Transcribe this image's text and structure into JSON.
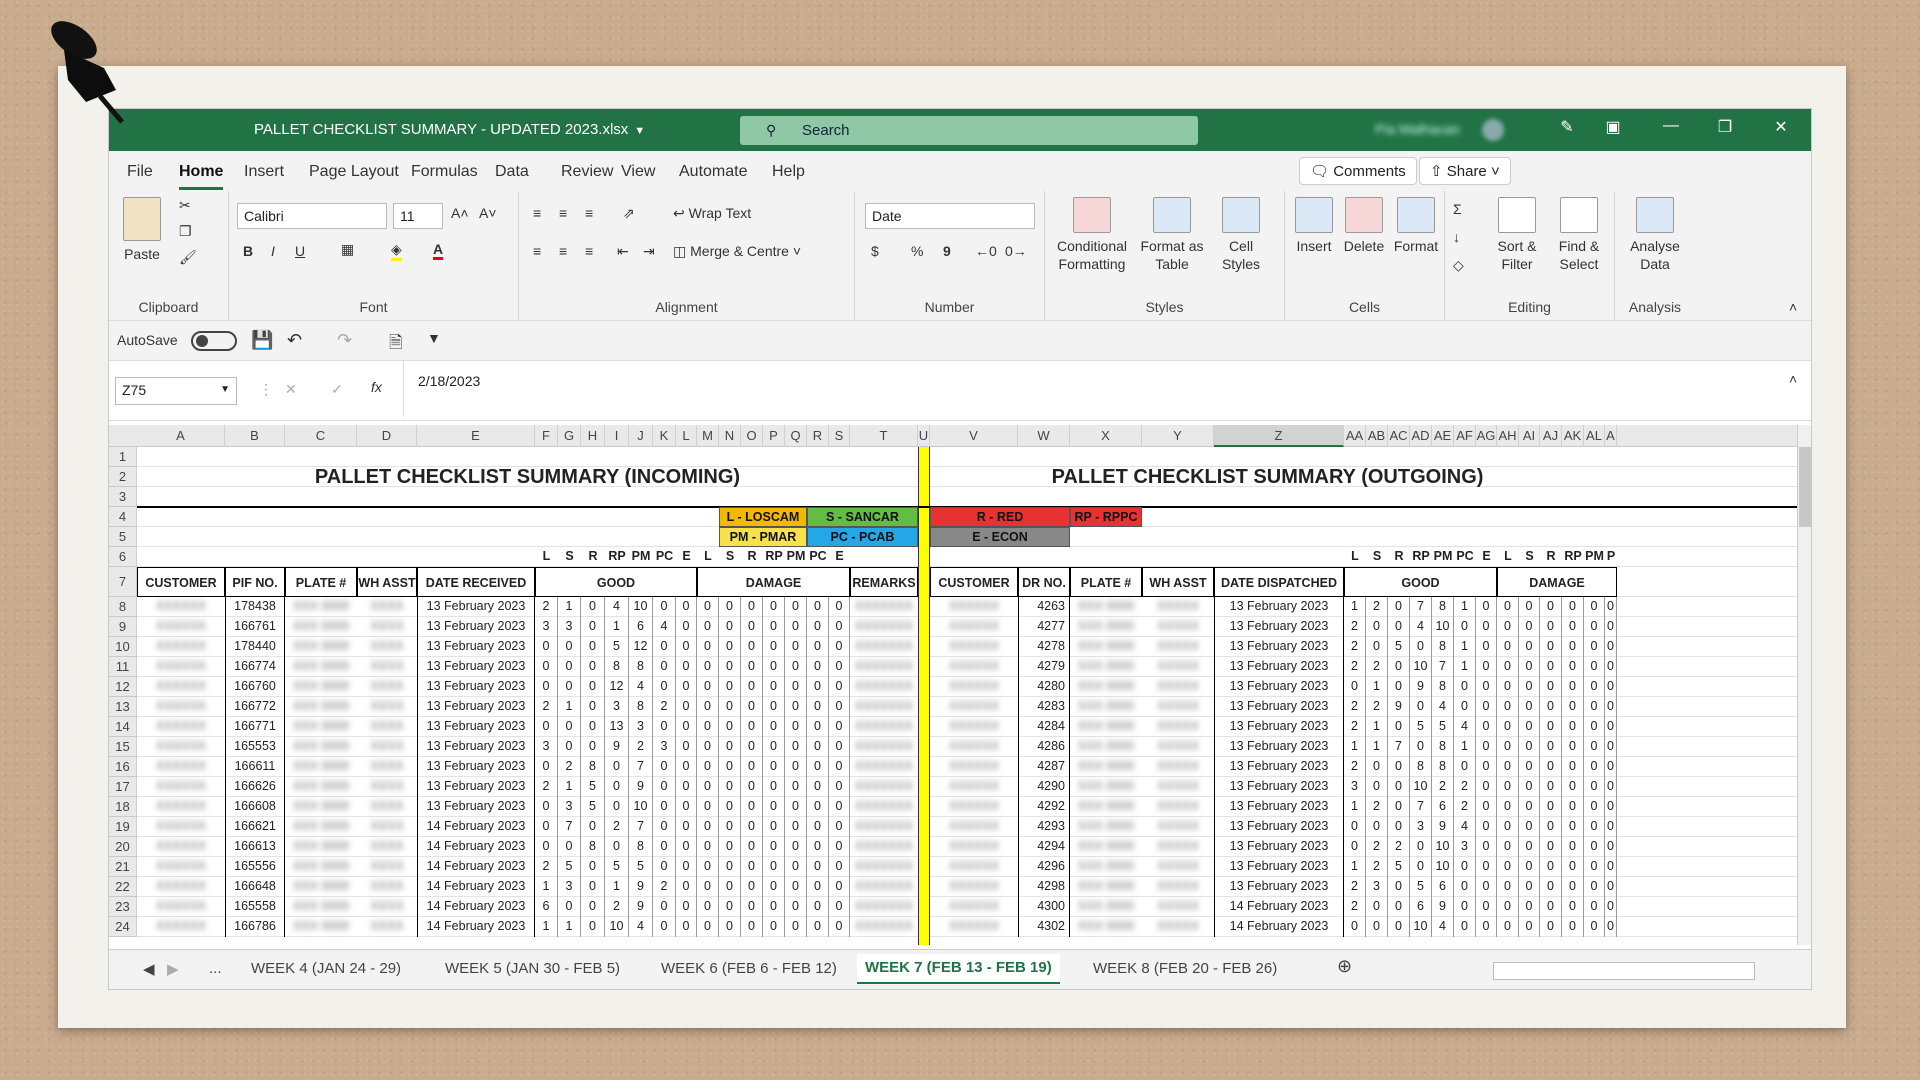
{
  "window": {
    "title": "PALLET CHECKLIST SUMMARY - UPDATED 2023.xlsx",
    "search_placeholder": "Search",
    "user": "Pia Malhacan"
  },
  "tabs": [
    "File",
    "Home",
    "Insert",
    "Page Layout",
    "Formulas",
    "Data",
    "Review",
    "View",
    "Automate",
    "Help"
  ],
  "active_tab": "Home",
  "ribbon_buttons": {
    "comments": "Comments",
    "share": "Share"
  },
  "ribbon": {
    "clipboard": {
      "paste": "Paste",
      "label": "Clipboard"
    },
    "font": {
      "name": "Calibri",
      "size": "11",
      "label": "Font",
      "bold": "B",
      "italic": "I",
      "underline": "U"
    },
    "alignment": {
      "wrap": "Wrap Text",
      "merge": "Merge & Centre",
      "label": "Alignment"
    },
    "number": {
      "format": "Date",
      "currency": "$",
      "percent": "%",
      "comma": "9",
      "label": "Number"
    },
    "styles": {
      "conditional": "Conditional Formatting",
      "format_table": "Format as Table",
      "cell_styles": "Cell Styles",
      "label": "Styles"
    },
    "cells": {
      "insert": "Insert",
      "delete": "Delete",
      "format": "Format",
      "label": "Cells"
    },
    "editing": {
      "sort": "Sort & Filter",
      "find": "Find & Select",
      "label": "Editing"
    },
    "analysis": {
      "analyse": "Analyse Data",
      "label": "Analysis"
    }
  },
  "qat": {
    "autosave": "AutoSave"
  },
  "formula_bar": {
    "name_box": "Z75",
    "value": "2/18/2023",
    "fx": "fx"
  },
  "columns_left": [
    "A",
    "B",
    "C",
    "D",
    "E",
    "F",
    "G",
    "H",
    "I",
    "J",
    "K",
    "L",
    "M",
    "N",
    "O",
    "P",
    "Q",
    "R",
    "S",
    "T",
    "U"
  ],
  "columns_right": [
    "V",
    "W",
    "X",
    "Y",
    "Z",
    "AA",
    "AB",
    "AC",
    "AD",
    "AE",
    "AF",
    "AG",
    "AH",
    "AI",
    "AJ",
    "AK",
    "AL",
    "A"
  ],
  "rows_nums": [
    "1",
    "2",
    "3",
    "4",
    "5",
    "6",
    "7",
    "8",
    "9",
    "10",
    "11",
    "12",
    "13",
    "14",
    "15",
    "16",
    "17",
    "18",
    "19",
    "20",
    "21",
    "22",
    "23",
    "24"
  ],
  "titles": {
    "incoming": "PALLET CHECKLIST SUMMARY (INCOMING)",
    "outgoing": "PALLET CHECKLIST SUMMARY (OUTGOING)"
  },
  "legend": [
    {
      "text": "L - LOSCAM",
      "bg": "#f5b800"
    },
    {
      "text": "S - SANCAR",
      "bg": "#63bd45"
    },
    {
      "text": "PM - PMAR",
      "bg": "#f7e24a"
    },
    {
      "text": "PC - PCAB",
      "bg": "#25a6e6"
    },
    {
      "text": "R - RED",
      "bg": "#e83232"
    },
    {
      "text": "RP - RPPC",
      "bg": "#e83232"
    },
    {
      "text": "E - ECON",
      "bg": "#888888"
    }
  ],
  "sub_codes_left": [
    "L",
    "S",
    "R",
    "RP",
    "PM",
    "PC",
    "E",
    "L",
    "S",
    "R",
    "RP",
    "PM",
    "PC",
    "E"
  ],
  "sub_codes_right": [
    "L",
    "S",
    "R",
    "RP",
    "PM",
    "PC",
    "E",
    "L",
    "S",
    "R",
    "RP",
    "PM",
    "P"
  ],
  "headers_left": [
    "CUSTOMER",
    "PIF NO.",
    "PLATE #",
    "WH ASST",
    "DATE RECEIVED",
    "GOOD",
    "DAMAGE",
    "REMARKS"
  ],
  "headers_right": [
    "CUSTOMER",
    "DR NO.",
    "PLATE #",
    "WH ASST",
    "DATE DISPATCHED",
    "GOOD",
    "DAMAGE"
  ],
  "incoming_rows": [
    {
      "pif": "178438",
      "date": "13 February 2023",
      "good": [
        "2",
        "1",
        "0",
        "4",
        "10",
        "0",
        "0"
      ],
      "damage": [
        "0",
        "0",
        "0",
        "0",
        "0",
        "0",
        "0"
      ]
    },
    {
      "pif": "166761",
      "date": "13 February 2023",
      "good": [
        "3",
        "3",
        "0",
        "1",
        "6",
        "4",
        "0"
      ],
      "damage": [
        "0",
        "0",
        "0",
        "0",
        "0",
        "0",
        "0"
      ]
    },
    {
      "pif": "178440",
      "date": "13 February 2023",
      "good": [
        "0",
        "0",
        "0",
        "5",
        "12",
        "0",
        "0"
      ],
      "damage": [
        "0",
        "0",
        "0",
        "0",
        "0",
        "0",
        "0"
      ]
    },
    {
      "pif": "166774",
      "date": "13 February 2023",
      "good": [
        "0",
        "0",
        "0",
        "8",
        "8",
        "0",
        "0"
      ],
      "damage": [
        "0",
        "0",
        "0",
        "0",
        "0",
        "0",
        "0"
      ]
    },
    {
      "pif": "166760",
      "date": "13 February 2023",
      "good": [
        "0",
        "0",
        "0",
        "12",
        "4",
        "0",
        "0"
      ],
      "damage": [
        "0",
        "0",
        "0",
        "0",
        "0",
        "0",
        "0"
      ]
    },
    {
      "pif": "166772",
      "date": "13 February 2023",
      "good": [
        "2",
        "1",
        "0",
        "3",
        "8",
        "2",
        "0"
      ],
      "damage": [
        "0",
        "0",
        "0",
        "0",
        "0",
        "0",
        "0"
      ]
    },
    {
      "pif": "166771",
      "date": "13 February 2023",
      "good": [
        "0",
        "0",
        "0",
        "13",
        "3",
        "0",
        "0"
      ],
      "damage": [
        "0",
        "0",
        "0",
        "0",
        "0",
        "0",
        "0"
      ]
    },
    {
      "pif": "165553",
      "date": "13 February 2023",
      "good": [
        "3",
        "0",
        "0",
        "9",
        "2",
        "3",
        "0"
      ],
      "damage": [
        "0",
        "0",
        "0",
        "0",
        "0",
        "0",
        "0"
      ]
    },
    {
      "pif": "166611",
      "date": "13 February 2023",
      "good": [
        "0",
        "2",
        "8",
        "0",
        "7",
        "0",
        "0"
      ],
      "damage": [
        "0",
        "0",
        "0",
        "0",
        "0",
        "0",
        "0"
      ]
    },
    {
      "pif": "166626",
      "date": "13 February 2023",
      "good": [
        "2",
        "1",
        "5",
        "0",
        "9",
        "0",
        "0"
      ],
      "damage": [
        "0",
        "0",
        "0",
        "0",
        "0",
        "0",
        "0"
      ]
    },
    {
      "pif": "166608",
      "date": "13 February 2023",
      "good": [
        "0",
        "3",
        "5",
        "0",
        "10",
        "0",
        "0"
      ],
      "damage": [
        "0",
        "0",
        "0",
        "0",
        "0",
        "0",
        "0"
      ]
    },
    {
      "pif": "166621",
      "date": "14 February 2023",
      "good": [
        "0",
        "7",
        "0",
        "2",
        "7",
        "0",
        "0"
      ],
      "damage": [
        "0",
        "0",
        "0",
        "0",
        "0",
        "0",
        "0"
      ]
    },
    {
      "pif": "166613",
      "date": "14 February 2023",
      "good": [
        "0",
        "0",
        "8",
        "0",
        "8",
        "0",
        "0"
      ],
      "damage": [
        "0",
        "0",
        "0",
        "0",
        "0",
        "0",
        "0"
      ]
    },
    {
      "pif": "165556",
      "date": "14 February 2023",
      "good": [
        "2",
        "5",
        "0",
        "5",
        "5",
        "0",
        "0"
      ],
      "damage": [
        "0",
        "0",
        "0",
        "0",
        "0",
        "0",
        "0"
      ]
    },
    {
      "pif": "166648",
      "date": "14 February 2023",
      "good": [
        "1",
        "3",
        "0",
        "1",
        "9",
        "2",
        "0"
      ],
      "damage": [
        "0",
        "0",
        "0",
        "0",
        "0",
        "0",
        "0"
      ]
    },
    {
      "pif": "165558",
      "date": "14 February 2023",
      "good": [
        "6",
        "0",
        "0",
        "2",
        "9",
        "0",
        "0"
      ],
      "damage": [
        "0",
        "0",
        "0",
        "0",
        "0",
        "0",
        "0"
      ]
    },
    {
      "pif": "166786",
      "date": "14 February 2023",
      "good": [
        "1",
        "1",
        "0",
        "10",
        "4",
        "0",
        "0"
      ],
      "damage": [
        "0",
        "0",
        "0",
        "0",
        "0",
        "0",
        "0"
      ]
    }
  ],
  "outgoing_rows": [
    {
      "dr": "4263",
      "date": "13 February 2023",
      "good": [
        "1",
        "2",
        "0",
        "7",
        "8",
        "1",
        "0"
      ],
      "damage": [
        "0",
        "0",
        "0",
        "0",
        "0",
        "0"
      ]
    },
    {
      "dr": "4277",
      "date": "13 February 2023",
      "good": [
        "2",
        "0",
        "0",
        "4",
        "10",
        "0",
        "0"
      ],
      "damage": [
        "0",
        "0",
        "0",
        "0",
        "0",
        "0"
      ]
    },
    {
      "dr": "4278",
      "date": "13 February 2023",
      "good": [
        "2",
        "0",
        "5",
        "0",
        "8",
        "1",
        "0"
      ],
      "damage": [
        "0",
        "0",
        "0",
        "0",
        "0",
        "0"
      ]
    },
    {
      "dr": "4279",
      "date": "13 February 2023",
      "good": [
        "2",
        "2",
        "0",
        "10",
        "7",
        "1",
        "0"
      ],
      "damage": [
        "0",
        "0",
        "0",
        "0",
        "0",
        "0"
      ]
    },
    {
      "dr": "4280",
      "date": "13 February 2023",
      "good": [
        "0",
        "1",
        "0",
        "9",
        "8",
        "0",
        "0"
      ],
      "damage": [
        "0",
        "0",
        "0",
        "0",
        "0",
        "0"
      ]
    },
    {
      "dr": "4283",
      "date": "13 February 2023",
      "good": [
        "2",
        "2",
        "9",
        "0",
        "4",
        "0",
        "0"
      ],
      "damage": [
        "0",
        "0",
        "0",
        "0",
        "0",
        "0"
      ]
    },
    {
      "dr": "4284",
      "date": "13 February 2023",
      "good": [
        "2",
        "1",
        "0",
        "5",
        "5",
        "4",
        "0"
      ],
      "damage": [
        "0",
        "0",
        "0",
        "0",
        "0",
        "0"
      ]
    },
    {
      "dr": "4286",
      "date": "13 February 2023",
      "good": [
        "1",
        "1",
        "7",
        "0",
        "8",
        "1",
        "0"
      ],
      "damage": [
        "0",
        "0",
        "0",
        "0",
        "0",
        "0"
      ]
    },
    {
      "dr": "4287",
      "date": "13 February 2023",
      "good": [
        "2",
        "0",
        "0",
        "8",
        "8",
        "0",
        "0"
      ],
      "damage": [
        "0",
        "0",
        "0",
        "0",
        "0",
        "0"
      ]
    },
    {
      "dr": "4290",
      "date": "13 February 2023",
      "good": [
        "3",
        "0",
        "0",
        "10",
        "2",
        "2",
        "0"
      ],
      "damage": [
        "0",
        "0",
        "0",
        "0",
        "0",
        "0"
      ]
    },
    {
      "dr": "4292",
      "date": "13 February 2023",
      "good": [
        "1",
        "2",
        "0",
        "7",
        "6",
        "2",
        "0"
      ],
      "damage": [
        "0",
        "0",
        "0",
        "0",
        "0",
        "0"
      ]
    },
    {
      "dr": "4293",
      "date": "13 February 2023",
      "good": [
        "0",
        "0",
        "0",
        "3",
        "9",
        "4",
        "0"
      ],
      "damage": [
        "0",
        "0",
        "0",
        "0",
        "0",
        "0"
      ]
    },
    {
      "dr": "4294",
      "date": "13 February 2023",
      "good": [
        "0",
        "2",
        "2",
        "0",
        "10",
        "3",
        "0"
      ],
      "damage": [
        "0",
        "0",
        "0",
        "0",
        "0",
        "0"
      ]
    },
    {
      "dr": "4296",
      "date": "13 February 2023",
      "good": [
        "1",
        "2",
        "5",
        "0",
        "10",
        "0",
        "0"
      ],
      "damage": [
        "0",
        "0",
        "0",
        "0",
        "0",
        "0"
      ]
    },
    {
      "dr": "4298",
      "date": "13 February 2023",
      "good": [
        "2",
        "3",
        "0",
        "5",
        "6",
        "0",
        "0"
      ],
      "damage": [
        "0",
        "0",
        "0",
        "0",
        "0",
        "0"
      ]
    },
    {
      "dr": "4300",
      "date": "14 February 2023",
      "good": [
        "2",
        "0",
        "0",
        "6",
        "9",
        "0",
        "0"
      ],
      "damage": [
        "0",
        "0",
        "0",
        "0",
        "0",
        "0"
      ]
    },
    {
      "dr": "4302",
      "date": "14 February 2023",
      "good": [
        "0",
        "0",
        "0",
        "10",
        "4",
        "0",
        "0"
      ],
      "damage": [
        "0",
        "0",
        "0",
        "0",
        "0",
        "0"
      ]
    }
  ],
  "sheet_tabs": [
    "...",
    "WEEK 4 (JAN 24 - 29)",
    "WEEK 5 (JAN 30 - FEB 5)",
    "WEEK 6 (FEB 6 - FEB 12)",
    "WEEK 7 (FEB 13 - FEB 19)",
    "WEEK 8 (FEB 20 - FEB 26)"
  ],
  "active_sheet": "WEEK 7 (FEB 13 - FEB 19)",
  "colors": {
    "excel_green": "#217346",
    "divider_yellow": "#ffff00"
  }
}
